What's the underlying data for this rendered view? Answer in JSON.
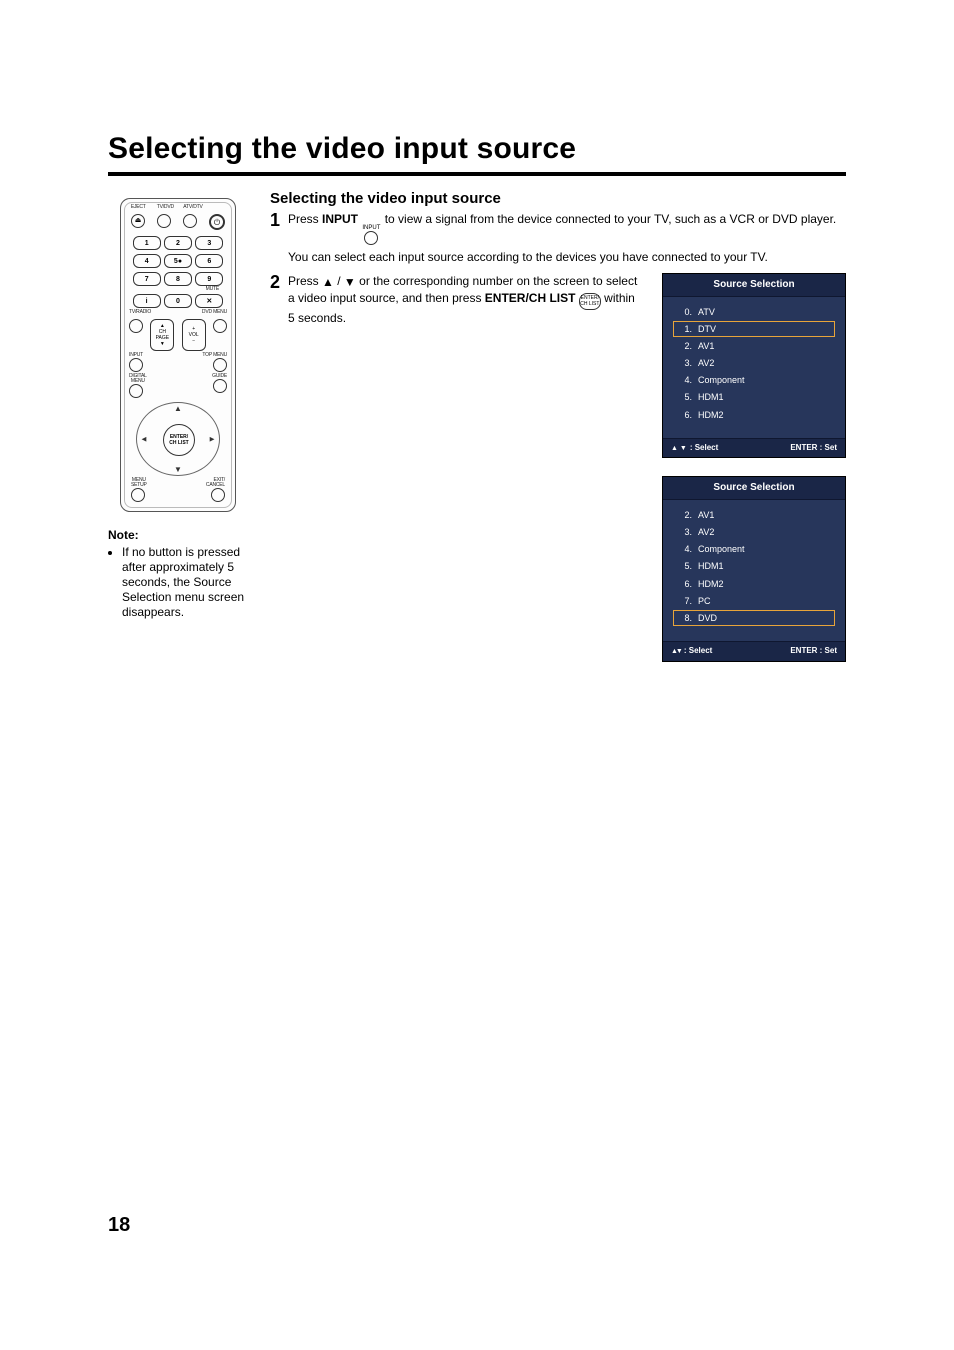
{
  "page": {
    "title": "Selecting the video input source",
    "number": "18"
  },
  "section": {
    "title": "Selecting the video input source",
    "step1_a": "Press ",
    "step1_input_label": "INPUT",
    "step1_input_tiny": "INPUT",
    "step1_b": " to view a signal from the device connected to your TV, such as a VCR or DVD player.",
    "step1_c": "You can select each input source according to the devices you have connected to your TV.",
    "step2_a": "Press ",
    "step2_slash": " / ",
    "step2_b": " or the corresponding number on the screen to select a video input source, and then press ",
    "step2_enter_label": "ENTER/CH LIST",
    "step2_enter_tiny_a": "ENTER/",
    "step2_enter_tiny_b": "CH LIST",
    "step2_c": " within 5 seconds.",
    "step_labels": {
      "s1": "1",
      "s2": "2"
    }
  },
  "note": {
    "heading": "Note:",
    "item": "If no button is pressed after approximately 5 seconds, the Source Selection menu screen disappears."
  },
  "osd_a": {
    "title": "Source Selection",
    "items": [
      {
        "n": "0",
        "label": "ATV",
        "selected": false
      },
      {
        "n": "1",
        "label": "DTV",
        "selected": true
      },
      {
        "n": "2",
        "label": "AV1",
        "selected": false
      },
      {
        "n": "3",
        "label": "AV2",
        "selected": false
      },
      {
        "n": "4",
        "label": "Component",
        "selected": false
      },
      {
        "n": "5",
        "label": "HDM1",
        "selected": false
      },
      {
        "n": "6",
        "label": "HDM2",
        "selected": false
      }
    ],
    "foot_left": ": Select",
    "foot_right": "ENTER : Set"
  },
  "osd_b": {
    "title": "Source Selection",
    "items": [
      {
        "n": "2",
        "label": "AV1",
        "selected": false
      },
      {
        "n": "3",
        "label": "AV2",
        "selected": false
      },
      {
        "n": "4",
        "label": "Component",
        "selected": false
      },
      {
        "n": "5",
        "label": "HDM1",
        "selected": false
      },
      {
        "n": "6",
        "label": "HDM2",
        "selected": false
      },
      {
        "n": "7",
        "label": "PC",
        "selected": false
      },
      {
        "n": "8",
        "label": "DVD",
        "selected": true
      }
    ],
    "foot_left": ": Select",
    "foot_right": "ENTER : Set"
  },
  "remote": {
    "top_labels": [
      "EJECT",
      "TV/DVD",
      "ATV/DTV",
      ""
    ],
    "nums": [
      [
        "1",
        "2",
        "3"
      ],
      [
        "4",
        "5●",
        "6"
      ],
      [
        "7",
        "8",
        "9"
      ],
      [
        "i",
        "0",
        ""
      ]
    ],
    "mute": "MUTE",
    "row_labels_l": "TV/RADIO",
    "row_labels_r": "DVD MENU",
    "mid_labels": {
      "input": "INPUT",
      "ch": "CH\nPAGE",
      "vol": "VOL",
      "top": "TOP MENU"
    },
    "row2_l": "DIGITAL\nMENU",
    "row2_r": "GUIDE",
    "dpad_center_a": "ENTER/",
    "dpad_center_b": "CH LIST",
    "bottom_l": "MENU\nSETUP",
    "bottom_r": "EXIT/\nCANCEL"
  }
}
